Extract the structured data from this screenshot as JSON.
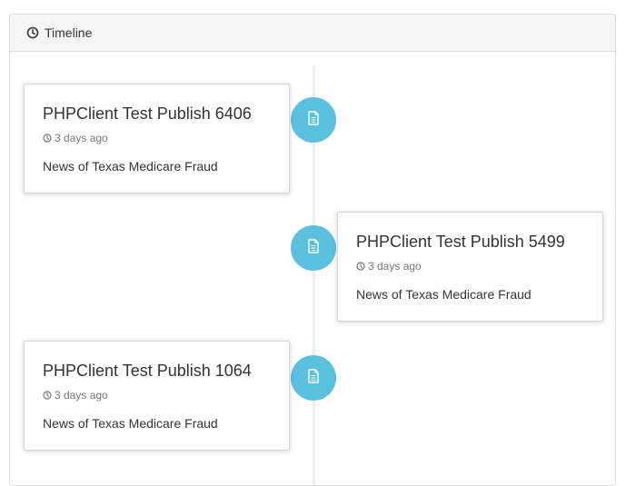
{
  "panel": {
    "title": "Timeline",
    "icon": "clock-icon"
  },
  "timeline": {
    "items": [
      {
        "side": "left",
        "title": "PHPClient Test Publish 6406",
        "time": "3 days ago",
        "body": "News of Texas Medicare Fraud",
        "badge_icon": "document-icon",
        "badge_color": "#5bc0de"
      },
      {
        "side": "right",
        "title": "PHPClient Test Publish 5499",
        "time": "3 days ago",
        "body": "News of Texas Medicare Fraud",
        "badge_icon": "document-icon",
        "badge_color": "#5bc0de"
      },
      {
        "side": "left",
        "title": "PHPClient Test Publish 1064",
        "time": "3 days ago",
        "body": "News of Texas Medicare Fraud",
        "badge_icon": "document-icon",
        "badge_color": "#5bc0de"
      }
    ]
  }
}
